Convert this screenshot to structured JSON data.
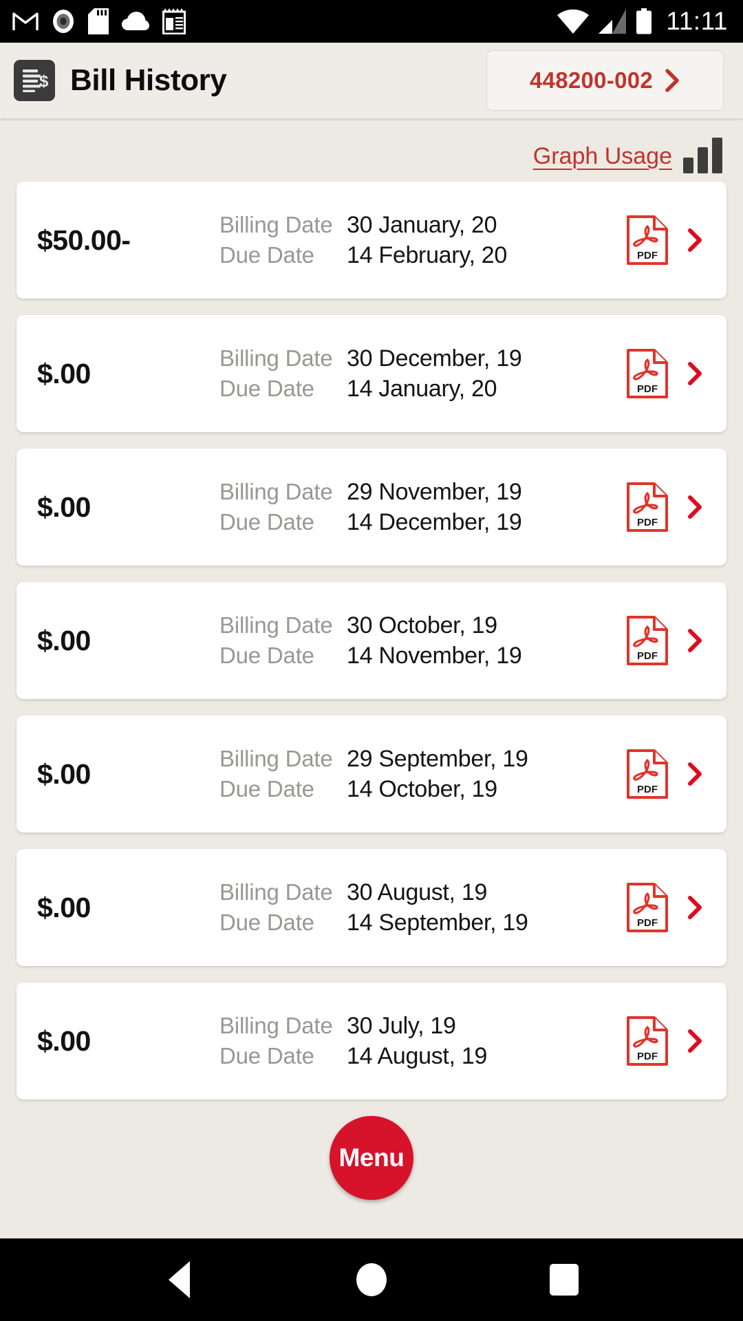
{
  "statusbar": {
    "icons": [
      "gmail-icon",
      "screen-record-icon",
      "sd-card-icon",
      "cloud-icon",
      "notepad-icon"
    ],
    "right_icons": [
      "wifi-icon",
      "cellular-signal-icon",
      "battery-icon"
    ],
    "time": "11:11"
  },
  "appbar": {
    "icon": "bill-document-icon",
    "title": "Bill History",
    "account_number": "448200-002",
    "account_chevron": "chevron-right-icon"
  },
  "toolbar": {
    "graph_usage_label": "Graph Usage",
    "graph_icon": "bar-chart-icon"
  },
  "labels": {
    "billing_date": "Billing Date",
    "due_date": "Due Date",
    "pdf_icon_text": "PDF"
  },
  "bills": [
    {
      "amount": "$50.00-",
      "billing_date": "30 January, 20",
      "due_date": "14 February, 20"
    },
    {
      "amount": "$.00",
      "billing_date": "30 December, 19",
      "due_date": "14 January, 20"
    },
    {
      "amount": "$.00",
      "billing_date": "29 November, 19",
      "due_date": "14 December, 19"
    },
    {
      "amount": "$.00",
      "billing_date": "30 October, 19",
      "due_date": "14 November, 19"
    },
    {
      "amount": "$.00",
      "billing_date": "29 September, 19",
      "due_date": "14 October, 19"
    },
    {
      "amount": "$.00",
      "billing_date": "30 August, 19",
      "due_date": "14 September, 19"
    },
    {
      "amount": "$.00",
      "billing_date": "30 July, 19",
      "due_date": "14 August, 19"
    }
  ],
  "fab": {
    "label": "Menu"
  },
  "navbar": {
    "back": "back-triangle-icon",
    "home": "home-circle-icon",
    "recents": "recents-square-icon"
  },
  "colors": {
    "accent_red": "#c0342c",
    "fab_red": "#d6132b",
    "page_bg": "#ede9e3",
    "card_bg": "#ffffff",
    "label_gray": "#9a9793"
  }
}
